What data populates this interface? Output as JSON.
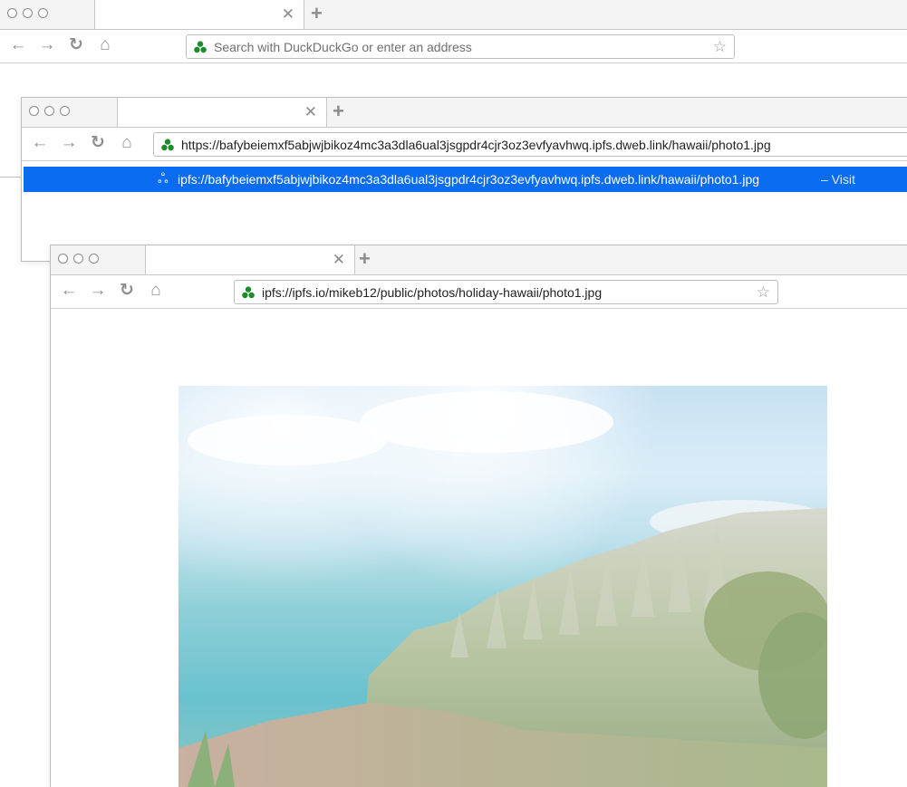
{
  "windows": [
    {
      "address": "",
      "placeholder": "Search with DuckDuckGo or enter an address"
    },
    {
      "address": "https://bafybeiemxf5abjwjbikoz4mc3a3dla6ual3jsgpdr4cjr3oz3evfyavhwq.ipfs.dweb.link/hawaii/photo1.jpg",
      "suggestion": {
        "text": "ipfs://bafybeiemxf5abjwjbikoz4mc3a3dla6ual3jsgpdr4cjr3oz3evfyavhwq.ipfs.dweb.link/hawaii/photo1.jpg",
        "action": "– Visit"
      }
    },
    {
      "address": "ipfs://ipfs.io/mikeb12/public/photos/holiday-hawaii/photo1.jpg"
    }
  ],
  "icons": {
    "close": "close-icon",
    "new_tab": "plus-icon",
    "back": "back-arrow-icon",
    "forward": "forward-arrow-icon",
    "reload": "reload-icon",
    "home": "home-icon",
    "bookmark": "star-icon",
    "site": "duckduckgo-logo-icon",
    "ipfs": "ipfs-icon"
  },
  "colors": {
    "highlight": "#0a6cf0",
    "logo_green": "#1a8c2a"
  }
}
